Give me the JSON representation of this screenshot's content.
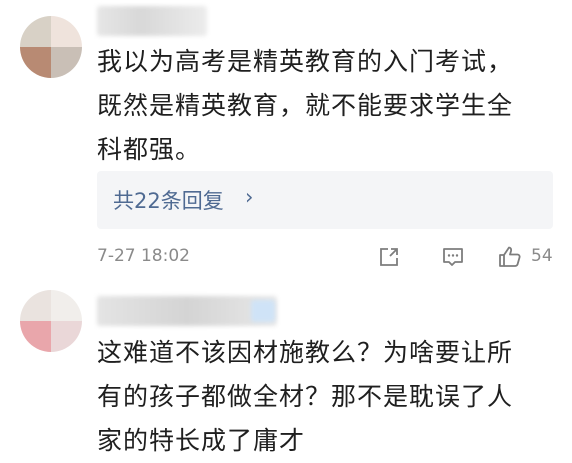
{
  "comments": [
    {
      "avatar_alt": "avatar",
      "text_lines": [
        "我以为高考是精英教育的入门考试，",
        "既然是精英教育，就不能要求学生全",
        "科都强。"
      ],
      "replies_label": "共22条回复",
      "replies_chevron": "›",
      "time": "7-27 18:02",
      "like_count": "54",
      "icons": [
        "share-icon",
        "comment-icon",
        "like-icon"
      ]
    },
    {
      "avatar_alt": "avatar",
      "text_lines": [
        "这难道不该因材施教么？为啥要让所",
        "有的孩子都做全材？那不是耽误了人",
        "家的特长成了庸才"
      ]
    }
  ],
  "colors": {
    "text": "#1f1f1f",
    "link": "#4f6a92",
    "meta": "#8a8a8a",
    "reply_bg": "#f4f5f7"
  }
}
